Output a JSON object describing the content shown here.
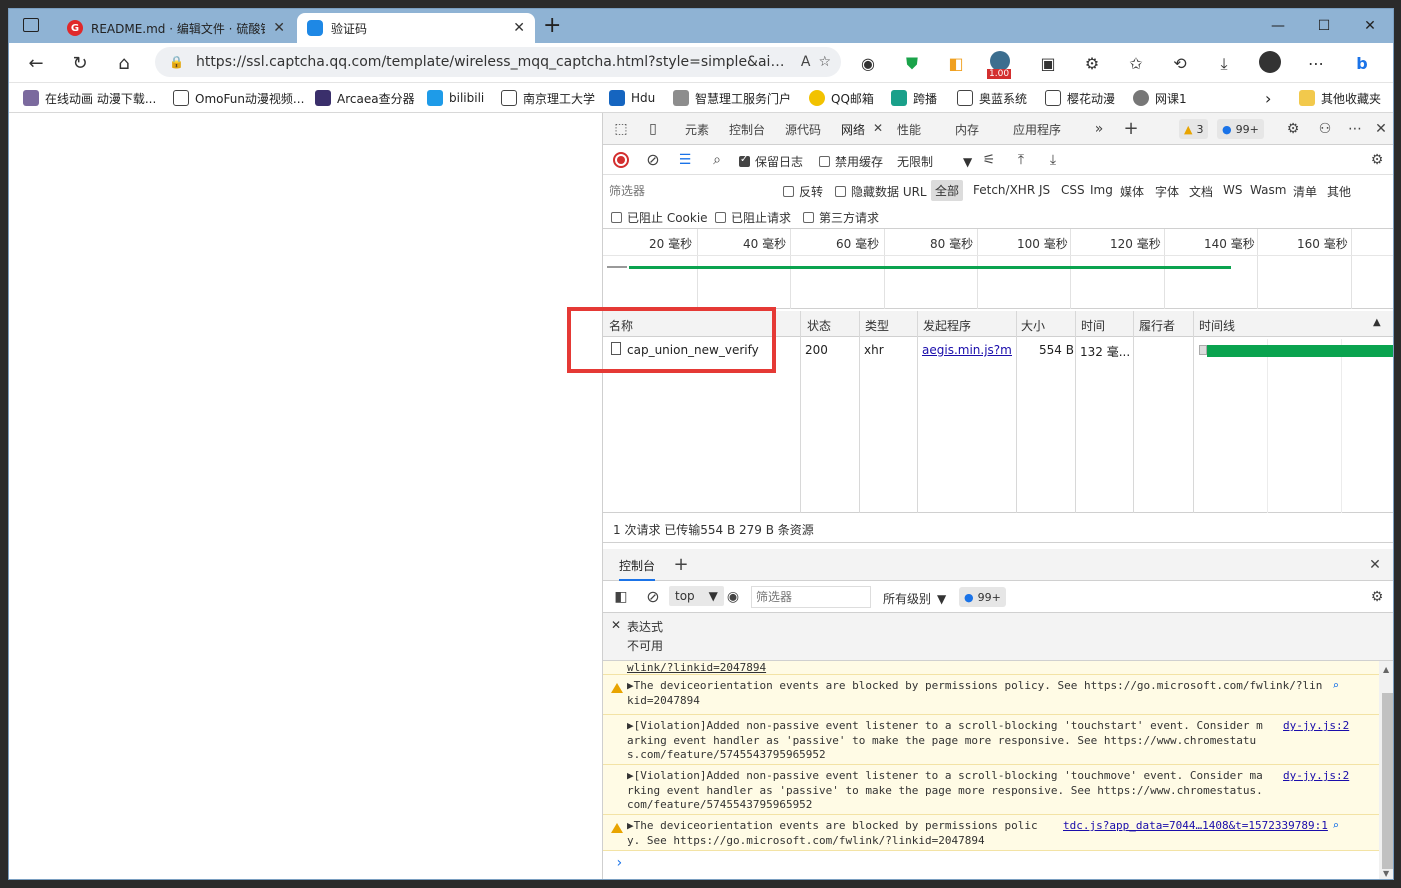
{
  "tabs": [
    {
      "title": "README.md · 编辑文件 · 硫酸钡",
      "active": false
    },
    {
      "title": "验证码",
      "active": true
    }
  ],
  "address": {
    "url": "https://ssl.captcha.qq.com/template/wireless_mqq_captcha.html?style=simple&aid=…"
  },
  "toolbar": {
    "ext_badge": "1.00"
  },
  "bookmarks": [
    "在线动画 动漫下载...",
    "OmoFun动漫视频...",
    "Arcaea查分器",
    "bilibili",
    "南京理工大学",
    "Hdu",
    "智慧理工服务门户",
    "QQ邮箱",
    "跨播",
    "奥蓝系统",
    "樱花动漫",
    "网课1",
    "其他收藏夹"
  ],
  "devtools": {
    "tabs": [
      "元素",
      "控制台",
      "源代码",
      "网络",
      "性能",
      "内存",
      "应用程序"
    ],
    "warn_count": "3",
    "msg_count": "99+",
    "net_toolbar": {
      "preserve_log": "保留日志",
      "disable_cache": "禁用缓存",
      "throttle": "无限制"
    },
    "filter": {
      "placeholder": "筛选器",
      "invert": "反转",
      "hide_data_url": "隐藏数据 URL",
      "types": [
        "全部",
        "Fetch/XHR",
        "JS",
        "CSS",
        "Img",
        "媒体",
        "字体",
        "文档",
        "WS",
        "Wasm",
        "清单",
        "其他"
      ],
      "blocked_cookie": "已阻止 Cookie",
      "blocked_req": "已阻止请求",
      "third_party": "第三方请求"
    },
    "overview_ticks": [
      "20 毫秒",
      "40 毫秒",
      "60 毫秒",
      "80 毫秒",
      "100 毫秒",
      "120 毫秒",
      "140 毫秒",
      "160 毫秒"
    ],
    "columns": [
      "名称",
      "状态",
      "类型",
      "发起程序",
      "大小",
      "时间",
      "履行者",
      "时间线"
    ],
    "rows": [
      {
        "name": "cap_union_new_verify",
        "status": "200",
        "type": "xhr",
        "initiator": "aegis.min.js?m...",
        "size": "554 B",
        "time": "132 毫..."
      }
    ],
    "summary": "1 次请求  已传输554 B  279 B 条资源",
    "drawer_tab": "控制台",
    "console_toolbar": {
      "context": "top",
      "filter_placeholder": "筛选器",
      "levels": "所有级别",
      "count": "99+"
    },
    "expression": {
      "label": "表达式",
      "value": "不可用"
    },
    "messages": [
      {
        "text": "wlink/?linkid=2047894",
        "warn": false,
        "src": ""
      },
      {
        "text": "▶The deviceorientation events are blocked by permissions policy. See https://go.microsoft.com/fwlink/?linkid=2047894",
        "warn": true,
        "src": ""
      },
      {
        "text": "▶[Violation]Added non-passive event listener to a scroll-blocking 'touchstart' event. Consider marking event handler as 'passive' to make the page more responsive. See https://www.chromestatus.com/feature/5745543795965952",
        "warn": false,
        "src": "dy-jy.js:2"
      },
      {
        "text": "▶[Violation]Added non-passive event listener to a scroll-blocking 'touchmove' event. Consider marking event handler as 'passive' to make the page more responsive. See https://www.chromestatus.com/feature/5745543795965952",
        "warn": false,
        "src": "dy-jy.js:2"
      },
      {
        "text": "▶The deviceorientation events are blocked by permissions policy. See https://go.microsoft.com/fwlink/?linkid=2047894",
        "warn": true,
        "src": "tdc.js?app_data=7044…1408&t=1572339789:1"
      }
    ],
    "prompt": "›"
  },
  "colors": {
    "accent": "#1a73e8",
    "warn_bg": "#fffbe5",
    "timeline_bar": "#0aa34f",
    "highlight": "#e53935"
  }
}
